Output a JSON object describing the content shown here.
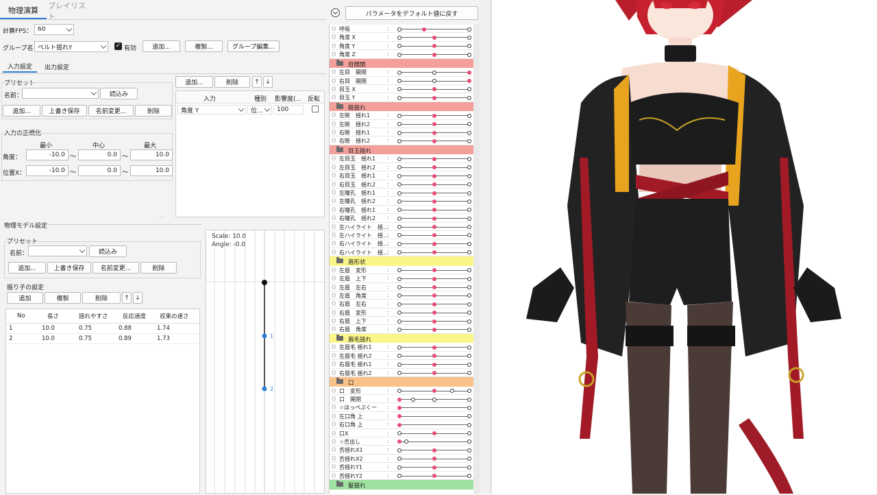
{
  "tabs": {
    "physics": "物理演算",
    "playlist": "プレイリスト"
  },
  "fps": {
    "label": "計算FPS：",
    "value": "60"
  },
  "group": {
    "label": "グループ名：",
    "value": "ベルト揺れY",
    "enabled_label": "有効",
    "enabled": true,
    "add": "追加...",
    "duplicate": "複製...",
    "edit": "グループ編集..."
  },
  "subtabs": {
    "input": "入力設定",
    "output": "出力設定"
  },
  "input_preset": {
    "title": "プリセット",
    "name_label": "名前：",
    "name_value": "",
    "load": "読込み",
    "add": "追加...",
    "overwrite": "上書き保存",
    "rename": "名前変更...",
    "delete": "削除"
  },
  "normalize": {
    "title": "入力の正規化",
    "cols": [
      "最小",
      "中心",
      "最大"
    ],
    "rows": [
      {
        "label": "角度：",
        "min": "-10.0",
        "center": "0.0",
        "max": "10.0"
      },
      {
        "label": "位置X：",
        "min": "-10.0",
        "center": "0.0",
        "max": "10.0"
      }
    ],
    "tilde": "〜"
  },
  "input_table": {
    "add": "追加...",
    "delete": "削除",
    "up": "↑",
    "down": "↓",
    "headers": [
      "入力",
      "種別",
      "影響度(...",
      "反転"
    ],
    "rows": [
      {
        "input": "角度 Y",
        "type": "位...",
        "weight": "100"
      }
    ]
  },
  "model": {
    "title": "物理モデル設定",
    "preset_title": "プリセット",
    "name_label": "名前：",
    "load": "読込み",
    "add": "追加...",
    "overwrite": "上書き保存",
    "rename": "名前変更...",
    "delete": "削除",
    "pendulum_title": "振り子の設定",
    "p_add": "追加",
    "p_dup": "複製",
    "p_del": "削除",
    "up": "↑",
    "down": "↓",
    "headers": [
      "No",
      "長さ",
      "揺れやすさ",
      "反応速度",
      "収束の速さ"
    ],
    "rows": [
      [
        "1",
        "10.0",
        "0.75",
        "0.88",
        "1.74"
      ],
      [
        "2",
        "10.0",
        "0.75",
        "0.89",
        "1.73"
      ]
    ]
  },
  "preview": {
    "scale": "Scale: 10.0",
    "angle": "Angle: -0.0",
    "node1": "1",
    "node2": "2"
  },
  "reset_button": "パラメータをデフォルト値に戻す",
  "param_list": [
    {
      "type": "param",
      "name": "呼吸",
      "dots": [
        [
          0,
          "o"
        ],
        [
          0.35,
          "r"
        ],
        [
          1,
          "o"
        ]
      ]
    },
    {
      "type": "param",
      "name": "角度 X",
      "dots": [
        [
          0,
          "o"
        ],
        [
          0.5,
          "r"
        ],
        [
          1,
          "o"
        ]
      ]
    },
    {
      "type": "param",
      "name": "角度 Y",
      "dots": [
        [
          0,
          "o"
        ],
        [
          0.5,
          "r"
        ],
        [
          1,
          "o"
        ]
      ]
    },
    {
      "type": "param",
      "name": "角度 Z",
      "dots": [
        [
          0,
          "o"
        ],
        [
          0.5,
          "r"
        ],
        [
          1,
          "o"
        ]
      ]
    },
    {
      "type": "group",
      "name": "目開閉",
      "color": "#f4a09a"
    },
    {
      "type": "param",
      "name": "左目　開閉",
      "dots": [
        [
          0,
          "o"
        ],
        [
          0.5,
          "o"
        ],
        [
          1,
          "r"
        ]
      ]
    },
    {
      "type": "param",
      "name": "右目　開閉",
      "dots": [
        [
          0,
          "o"
        ],
        [
          0.5,
          "o"
        ],
        [
          1,
          "r"
        ]
      ]
    },
    {
      "type": "param",
      "name": "目玉 X",
      "dots": [
        [
          0,
          "o"
        ],
        [
          0.5,
          "r"
        ],
        [
          1,
          "o"
        ]
      ]
    },
    {
      "type": "param",
      "name": "目玉 Y",
      "dots": [
        [
          0,
          "o"
        ],
        [
          0.5,
          "r"
        ],
        [
          1,
          "o"
        ]
      ]
    },
    {
      "type": "group",
      "name": "瞼揺れ",
      "color": "#f4a09a"
    },
    {
      "type": "param",
      "name": "左瞼　揺れ1",
      "dots": [
        [
          0,
          "o"
        ],
        [
          0.5,
          "r"
        ],
        [
          1,
          "o"
        ]
      ]
    },
    {
      "type": "param",
      "name": "左瞼　揺れ2",
      "dots": [
        [
          0,
          "o"
        ],
        [
          0.5,
          "r"
        ],
        [
          1,
          "o"
        ]
      ]
    },
    {
      "type": "param",
      "name": "右瞼　揺れ1",
      "dots": [
        [
          0,
          "o"
        ],
        [
          0.5,
          "r"
        ],
        [
          1,
          "o"
        ]
      ]
    },
    {
      "type": "param",
      "name": "右瞼　揺れ2",
      "dots": [
        [
          0,
          "o"
        ],
        [
          0.5,
          "r"
        ],
        [
          1,
          "o"
        ]
      ]
    },
    {
      "type": "group",
      "name": "目玉揺れ",
      "color": "#f4a09a"
    },
    {
      "type": "param",
      "name": "左目玉　揺れ1",
      "dots": [
        [
          0,
          "o"
        ],
        [
          0.5,
          "r"
        ],
        [
          1,
          "o"
        ]
      ]
    },
    {
      "type": "param",
      "name": "左目玉　揺れ2",
      "dots": [
        [
          0,
          "o"
        ],
        [
          0.5,
          "r"
        ],
        [
          1,
          "o"
        ]
      ]
    },
    {
      "type": "param",
      "name": "右目玉　揺れ1",
      "dots": [
        [
          0,
          "o"
        ],
        [
          0.5,
          "r"
        ],
        [
          1,
          "o"
        ]
      ]
    },
    {
      "type": "param",
      "name": "右目玉　揺れ2",
      "dots": [
        [
          0,
          "o"
        ],
        [
          0.5,
          "r"
        ],
        [
          1,
          "o"
        ]
      ]
    },
    {
      "type": "param",
      "name": "左瞳孔　揺れ1",
      "dots": [
        [
          0,
          "o"
        ],
        [
          0.5,
          "r"
        ],
        [
          1,
          "o"
        ]
      ]
    },
    {
      "type": "param",
      "name": "左瞳孔　揺れ2",
      "dots": [
        [
          0,
          "o"
        ],
        [
          0.5,
          "r"
        ],
        [
          1,
          "o"
        ]
      ]
    },
    {
      "type": "param",
      "name": "右瞳孔　揺れ1",
      "dots": [
        [
          0,
          "o"
        ],
        [
          0.5,
          "r"
        ],
        [
          1,
          "o"
        ]
      ]
    },
    {
      "type": "param",
      "name": "右瞳孔　揺れ2",
      "dots": [
        [
          0,
          "o"
        ],
        [
          0.5,
          "r"
        ],
        [
          1,
          "o"
        ]
      ]
    },
    {
      "type": "param",
      "name": "左ハイライト　揺...",
      "dots": [
        [
          0,
          "o"
        ],
        [
          0.5,
          "r"
        ],
        [
          1,
          "o"
        ]
      ]
    },
    {
      "type": "param",
      "name": "左ハイライト　揺...",
      "dots": [
        [
          0,
          "o"
        ],
        [
          0.5,
          "r"
        ],
        [
          1,
          "o"
        ]
      ]
    },
    {
      "type": "param",
      "name": "右ハイライト　揺...",
      "dots": [
        [
          0,
          "o"
        ],
        [
          0.5,
          "r"
        ],
        [
          1,
          "o"
        ]
      ]
    },
    {
      "type": "param",
      "name": "右ハイライト　揺...",
      "dots": [
        [
          0,
          "o"
        ],
        [
          0.5,
          "r"
        ],
        [
          1,
          "o"
        ]
      ]
    },
    {
      "type": "group",
      "name": "眉形状",
      "color": "#fbf68a"
    },
    {
      "type": "param",
      "name": "左眉　変形",
      "dots": [
        [
          0,
          "o"
        ],
        [
          0.5,
          "r"
        ],
        [
          1,
          "o"
        ]
      ]
    },
    {
      "type": "param",
      "name": "左眉　上下",
      "dots": [
        [
          0,
          "o"
        ],
        [
          0.5,
          "r"
        ],
        [
          1,
          "o"
        ]
      ]
    },
    {
      "type": "param",
      "name": "左眉　左右",
      "dots": [
        [
          0,
          "o"
        ],
        [
          0.5,
          "r"
        ],
        [
          1,
          "o"
        ]
      ]
    },
    {
      "type": "param",
      "name": "左眉　角度",
      "dots": [
        [
          0,
          "o"
        ],
        [
          0.5,
          "r"
        ],
        [
          1,
          "o"
        ]
      ]
    },
    {
      "type": "param",
      "name": "右眉　左右",
      "dots": [
        [
          0,
          "o"
        ],
        [
          0.5,
          "r"
        ],
        [
          1,
          "o"
        ]
      ]
    },
    {
      "type": "param",
      "name": "右眉　変形",
      "dots": [
        [
          0,
          "o"
        ],
        [
          0.5,
          "r"
        ],
        [
          1,
          "o"
        ]
      ]
    },
    {
      "type": "param",
      "name": "右眉　上下",
      "dots": [
        [
          0,
          "o"
        ],
        [
          0.5,
          "r"
        ],
        [
          1,
          "o"
        ]
      ]
    },
    {
      "type": "param",
      "name": "右眉　角度",
      "dots": [
        [
          0,
          "o"
        ],
        [
          0.5,
          "r"
        ],
        [
          1,
          "o"
        ]
      ]
    },
    {
      "type": "group",
      "name": "眉毛揺れ",
      "color": "#fbf68a"
    },
    {
      "type": "param",
      "name": "左眉毛 揺れ1",
      "dots": [
        [
          0,
          "o"
        ],
        [
          0.5,
          "r"
        ],
        [
          1,
          "o"
        ]
      ]
    },
    {
      "type": "param",
      "name": "左眉毛 揺れ2",
      "dots": [
        [
          0,
          "o"
        ],
        [
          0.5,
          "r"
        ],
        [
          1,
          "o"
        ]
      ]
    },
    {
      "type": "param",
      "name": "右眉毛 揺れ1",
      "dots": [
        [
          0,
          "o"
        ],
        [
          0.5,
          "r"
        ],
        [
          1,
          "o"
        ]
      ]
    },
    {
      "type": "param",
      "name": "右眉毛 揺れ2",
      "dots": [
        [
          0,
          "o"
        ],
        [
          0.5,
          "r"
        ],
        [
          1,
          "o"
        ]
      ]
    },
    {
      "type": "group",
      "name": "口",
      "color": "#f9c289"
    },
    {
      "type": "param",
      "name": "口　変形",
      "dots": [
        [
          0,
          "o"
        ],
        [
          0.5,
          "r"
        ],
        [
          0.75,
          "o"
        ],
        [
          1,
          "o"
        ]
      ]
    },
    {
      "type": "param",
      "name": "口　開閉",
      "dots": [
        [
          0,
          "r"
        ],
        [
          0.2,
          "o"
        ],
        [
          0.5,
          "o"
        ],
        [
          1,
          "o"
        ]
      ]
    },
    {
      "type": "param",
      "name": "☆ほっぺぷくー",
      "dots": [
        [
          0,
          "r"
        ],
        [
          1,
          "o"
        ]
      ]
    },
    {
      "type": "param",
      "name": "左口角 上",
      "dots": [
        [
          0,
          "r"
        ],
        [
          1,
          "o"
        ]
      ]
    },
    {
      "type": "param",
      "name": "右口角 上",
      "dots": [
        [
          0,
          "r"
        ],
        [
          1,
          "o"
        ]
      ]
    },
    {
      "type": "param",
      "name": "口X",
      "dots": [
        [
          0,
          "o"
        ],
        [
          0.5,
          "r"
        ],
        [
          1,
          "o"
        ]
      ]
    },
    {
      "type": "param",
      "name": "☆舌出し",
      "dots": [
        [
          0,
          "r"
        ],
        [
          0.1,
          "o"
        ],
        [
          1,
          "o"
        ]
      ]
    },
    {
      "type": "param",
      "name": "舌揺れX1",
      "dots": [
        [
          0,
          "o"
        ],
        [
          0.5,
          "r"
        ],
        [
          1,
          "o"
        ]
      ]
    },
    {
      "type": "param",
      "name": "舌揺れX2",
      "dots": [
        [
          0,
          "o"
        ],
        [
          0.5,
          "r"
        ],
        [
          1,
          "o"
        ]
      ]
    },
    {
      "type": "param",
      "name": "舌揺れY1",
      "dots": [
        [
          0,
          "o"
        ],
        [
          0.5,
          "r"
        ],
        [
          1,
          "o"
        ]
      ]
    },
    {
      "type": "param",
      "name": "舌揺れY2",
      "dots": [
        [
          0,
          "o"
        ],
        [
          0.5,
          "r"
        ],
        [
          1,
          "o"
        ]
      ]
    },
    {
      "type": "group",
      "name": "髪揺れ",
      "color": "#9fe29f"
    }
  ],
  "colors": {
    "accent": "#2f7fd3",
    "param_dot": "#e94d74"
  }
}
